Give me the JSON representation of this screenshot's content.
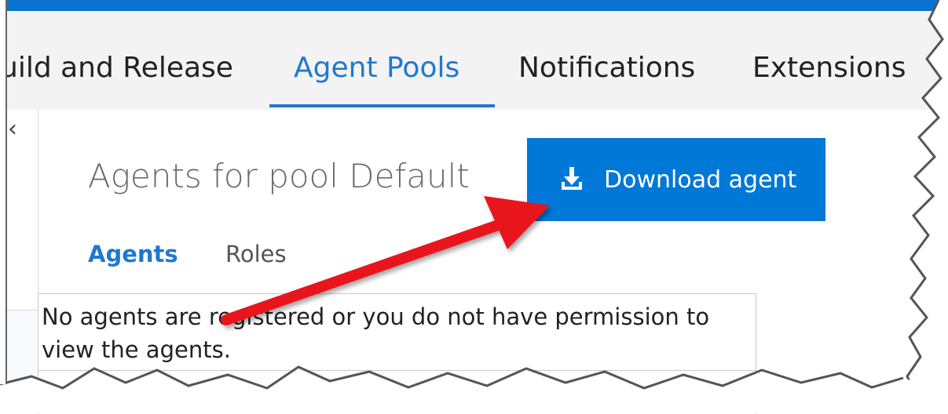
{
  "top_nav": {
    "tabs": [
      {
        "label": "uild and Release",
        "active": false
      },
      {
        "label": "Agent Pools",
        "active": true
      },
      {
        "label": "Notifications",
        "active": false
      },
      {
        "label": "Extensions",
        "active": false
      }
    ]
  },
  "left_rail": {
    "collapse_icon": "chevron-left-icon"
  },
  "header": {
    "title": "Agents for pool Default",
    "download_button_label": "Download agent",
    "download_icon": "download-icon"
  },
  "sub_tabs": [
    {
      "label": "Agents",
      "active": true
    },
    {
      "label": "Roles",
      "active": false
    }
  ],
  "agents_grid": {
    "empty_message": "No agents are registered or you do not have permission to view the agents."
  },
  "colors": {
    "accent": "#1f78cf",
    "button_bg": "#0078d7",
    "annotation_arrow": "#e8191b"
  }
}
